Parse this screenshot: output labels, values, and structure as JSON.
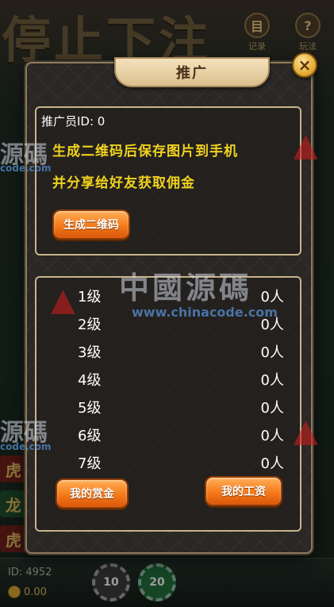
{
  "background": {
    "banner_text": "停止下注",
    "top_buttons": [
      {
        "icon": "record-icon",
        "label": "记录",
        "glyph": "目"
      },
      {
        "icon": "help-icon",
        "label": "玩法",
        "glyph": "?"
      }
    ],
    "side_tiles": [
      {
        "label": "虎",
        "color": "#6a1e1a"
      },
      {
        "label": "龙",
        "color": "#1e4a2a"
      },
      {
        "label": "虎",
        "color": "#6a1e1a"
      }
    ],
    "player_id": "ID: 4952",
    "balance": "0.00",
    "chips": [
      {
        "label": "10",
        "color": "#3a3a3a"
      },
      {
        "label": "20",
        "color": "#1f6a3a"
      }
    ]
  },
  "watermark": {
    "title": "中國源碼",
    "url": "www.chinacode.com",
    "side_text": "源碼",
    "side_url": "code.com"
  },
  "modal": {
    "title": "推广",
    "close_glyph": "×",
    "promoter_id": "推广员ID: 0",
    "promo_text_line1": "生成二维码后保存图片到手机",
    "promo_text_line2": "并分享给好友获取佣金",
    "generate_qr_button": "生成二维码",
    "levels": [
      {
        "level": "1级",
        "count": "0人"
      },
      {
        "level": "2级",
        "count": "0人"
      },
      {
        "level": "3级",
        "count": "0人"
      },
      {
        "level": "4级",
        "count": "0人"
      },
      {
        "level": "5级",
        "count": "0人"
      },
      {
        "level": "6级",
        "count": "0人"
      },
      {
        "level": "7级",
        "count": "0人"
      }
    ],
    "my_bounty_button": "我的赏金",
    "my_wage_button": "我的工资"
  }
}
